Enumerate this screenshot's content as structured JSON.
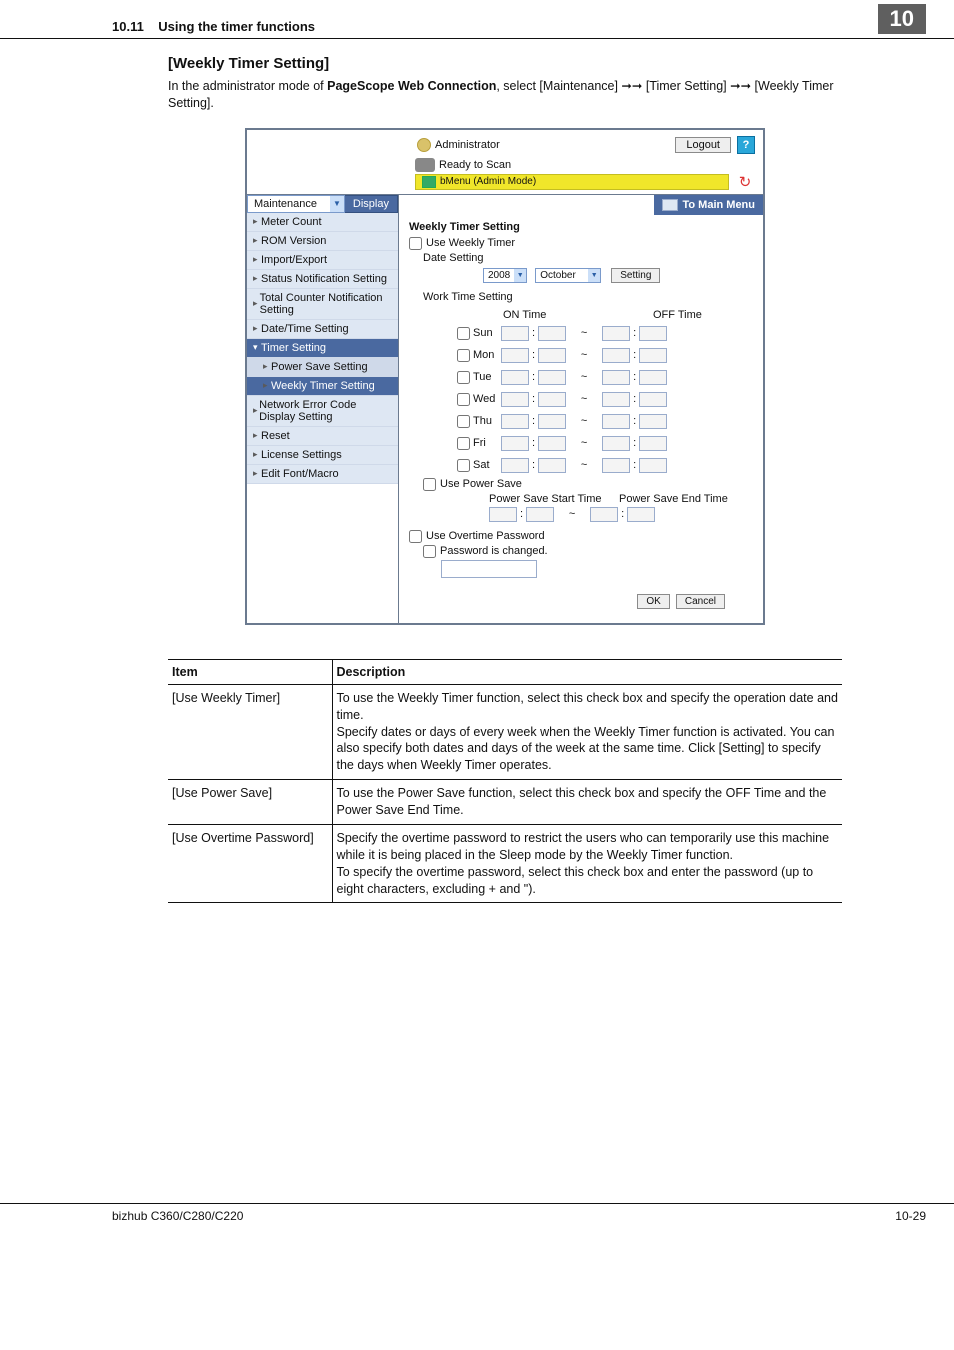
{
  "header": {
    "section": "10.11",
    "title": "Using the timer functions",
    "chapter": "10"
  },
  "section": {
    "heading": "[Weekly Timer Setting]",
    "intro": "In the administrator mode of PageScope Web Connection, select [Maintenance] ➞➞ [Timer Setting] ➞➞ [Weekly Timer Setting].",
    "intro_bold": "PageScope Web Connection"
  },
  "ui": {
    "administrator": "Administrator",
    "logout": "Logout",
    "help_glyph": "?",
    "ready": "Ready to Scan",
    "submenu": "bMenu (Admin Mode)",
    "refresh_glyph": "↻",
    "maint_select": "Maintenance",
    "display": "Display",
    "to_main": "To Main Menu",
    "nav": [
      "Meter Count",
      "ROM Version",
      "Import/Export",
      "Status Notification Setting",
      "Total Counter Notification Setting",
      "Date/Time Setting",
      "Timer Setting",
      "Power Save Setting",
      "Weekly Timer Setting",
      "Network Error Code Display Setting",
      "Reset",
      "License Settings",
      "Edit Font/Macro"
    ],
    "main": {
      "title": "Weekly Timer Setting",
      "use_weekly": "Use Weekly Timer",
      "date_setting": "Date Setting",
      "year": "2008",
      "month": "October",
      "setting_btn": "Setting",
      "work_time": "Work Time Setting",
      "on_time": "ON Time",
      "off_time": "OFF Time",
      "days": [
        "Sun",
        "Mon",
        "Tue",
        "Wed",
        "Thu",
        "Fri",
        "Sat"
      ],
      "use_power_save": "Use Power Save",
      "ps_start": "Power Save Start Time",
      "ps_end": "Power Save End Time",
      "use_overtime": "Use Overtime Password",
      "pw_changed": "Password is changed.",
      "ok": "OK",
      "cancel": "Cancel",
      "tilde": "~",
      "colon": ":",
      "check_glyph": "▢"
    }
  },
  "table": {
    "headers": [
      "Item",
      "Description"
    ],
    "rows": [
      {
        "item": "[Use Weekly Timer]",
        "desc": "To use the Weekly Timer function, select this check box and specify the operation date and time.\nSpecify dates or days of every week when the Weekly Timer function is activated. You can also specify both dates and days of the week at the same time. Click [Setting] to specify the days when Weekly Timer operates."
      },
      {
        "item": "[Use Power Save]",
        "desc": "To use the Power Save function, select this check box and specify the OFF Time and the Power Save End Time."
      },
      {
        "item": "[Use Overtime Password]",
        "desc": "Specify the overtime password to restrict the users who can temporarily use this machine while it is being placed in the Sleep mode by the Weekly Timer function.\nTo specify the overtime password, select this check box and enter the password (up to eight characters, excluding + and \")."
      }
    ]
  },
  "footer": {
    "model": "bizhub C360/C280/C220",
    "page": "10-29"
  }
}
